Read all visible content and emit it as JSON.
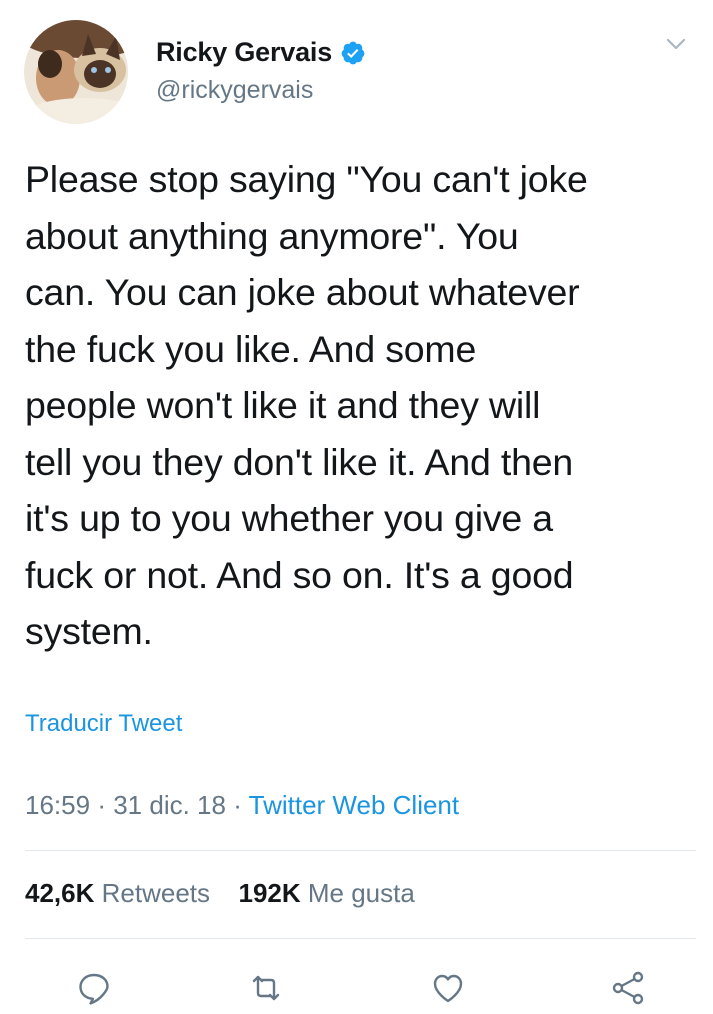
{
  "author": {
    "name": "Ricky Gervais",
    "handle": "@rickygervais",
    "verified": true
  },
  "tweet": {
    "text": "Please stop saying \"You can't joke\nabout anything anymore\". You\ncan. You can joke about whatever\nthe fuck you like. And some\npeople won't like it and they will\ntell you they don't like it. And then\nit's up to you whether you give a\nfuck or not. And so on. It's a good\nsystem.",
    "translate_label": "Traducir Tweet"
  },
  "meta": {
    "time": "16:59",
    "date": "31 dic. 18",
    "separator": "·",
    "source": "Twitter Web Client"
  },
  "stats": {
    "retweets_count": "42,6K",
    "retweets_label": "Retweets",
    "likes_count": "192K",
    "likes_label": "Me gusta"
  },
  "icons": {
    "verified": "verified-badge-icon",
    "menu": "chevron-down-icon",
    "reply": "reply-icon",
    "retweet": "retweet-icon",
    "like": "heart-icon",
    "share": "share-icon"
  },
  "colors": {
    "link": "#1b95e0",
    "secondary_text": "#657786",
    "verified": "#1da1f2",
    "divider": "#e1e8ed",
    "icon": "#657786"
  }
}
